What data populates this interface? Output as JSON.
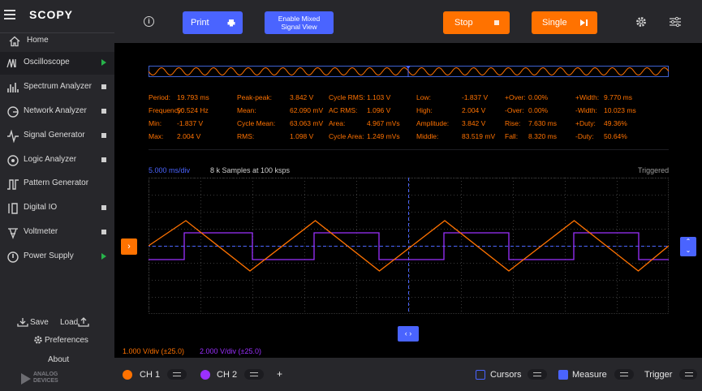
{
  "app": {
    "name": "SCOPY"
  },
  "sidebar": {
    "home": "Home",
    "items": [
      {
        "label": "Oscilloscope",
        "icon": "oscilloscope-icon",
        "status": "running"
      },
      {
        "label": "Spectrum Analyzer",
        "icon": "spectrum-icon",
        "status": "stopped"
      },
      {
        "label": "Network Analyzer",
        "icon": "network-icon",
        "status": "stopped"
      },
      {
        "label": "Signal Generator",
        "icon": "signal-icon",
        "status": "stopped"
      },
      {
        "label": "Logic Analyzer",
        "icon": "logic-icon",
        "status": "stopped"
      },
      {
        "label": "Pattern Generator",
        "icon": "pattern-icon",
        "status": "none"
      },
      {
        "label": "Digital IO",
        "icon": "digital-io-icon",
        "status": "stopped"
      },
      {
        "label": "Voltmeter",
        "icon": "voltmeter-icon",
        "status": "stopped"
      },
      {
        "label": "Power Supply",
        "icon": "power-icon",
        "status": "running"
      }
    ],
    "save": "Save",
    "load": "Load",
    "preferences": "Preferences",
    "about": "About",
    "logo_line1": "ANALOG",
    "logo_line2": "DEVICES"
  },
  "toolbar": {
    "print": "Print",
    "mixed_line1": "Enable Mixed",
    "mixed_line2": "Signal View",
    "stop": "Stop",
    "single": "Single"
  },
  "measurements": [
    {
      "label": "Period:",
      "value": "19.793 ms"
    },
    {
      "label": "Frequency:",
      "value": "50.524 Hz"
    },
    {
      "label": "Min:",
      "value": "-1.837 V"
    },
    {
      "label": "Max:",
      "value": "2.004 V"
    },
    {
      "label": "Peak-peak:",
      "value": "3.842 V"
    },
    {
      "label": "Mean:",
      "value": "62.090 mV"
    },
    {
      "label": "Cycle Mean:",
      "value": "63.063 mV"
    },
    {
      "label": "RMS:",
      "value": "1.098 V"
    },
    {
      "label": "Cycle RMS:",
      "value": "1.103 V"
    },
    {
      "label": "AC RMS:",
      "value": "1.096 V"
    },
    {
      "label": "Area:",
      "value": "4.967 mVs"
    },
    {
      "label": "Cycle Area:",
      "value": "1.249 mVs"
    },
    {
      "label": "Low:",
      "value": "-1.837 V"
    },
    {
      "label": "High:",
      "value": "2.004 V"
    },
    {
      "label": "Amplitude:",
      "value": "3.842 V"
    },
    {
      "label": "Middle:",
      "value": "83.519 mV"
    },
    {
      "label": "+Over:",
      "value": "0.00%"
    },
    {
      "label": "-Over:",
      "value": "0.00%"
    },
    {
      "label": "Rise:",
      "value": "7.630 ms"
    },
    {
      "label": "Fall:",
      "value": "8.320 ms"
    },
    {
      "label": "+Width:",
      "value": "9.770 ms"
    },
    {
      "label": "-Width:",
      "value": "10.023 ms"
    },
    {
      "label": "+Duty:",
      "value": "49.36%"
    },
    {
      "label": "-Duty:",
      "value": "50.64%"
    }
  ],
  "plot": {
    "time_div": "5.000 ms/div",
    "samples": "8 k Samples at 100 ksps",
    "status": "Triggered",
    "ch1_scale": "1.000 V/div (±25.0)",
    "ch2_scale": "2.000 V/div (±25.0)"
  },
  "colors": {
    "ch1": "#ff7200",
    "ch2": "#9b30ff",
    "accent": "#4a64ff"
  },
  "bottom": {
    "ch1": "CH 1",
    "ch2": "CH 2",
    "add": "+",
    "cursors": "Cursors",
    "measure": "Measure",
    "trigger": "Trigger"
  }
}
